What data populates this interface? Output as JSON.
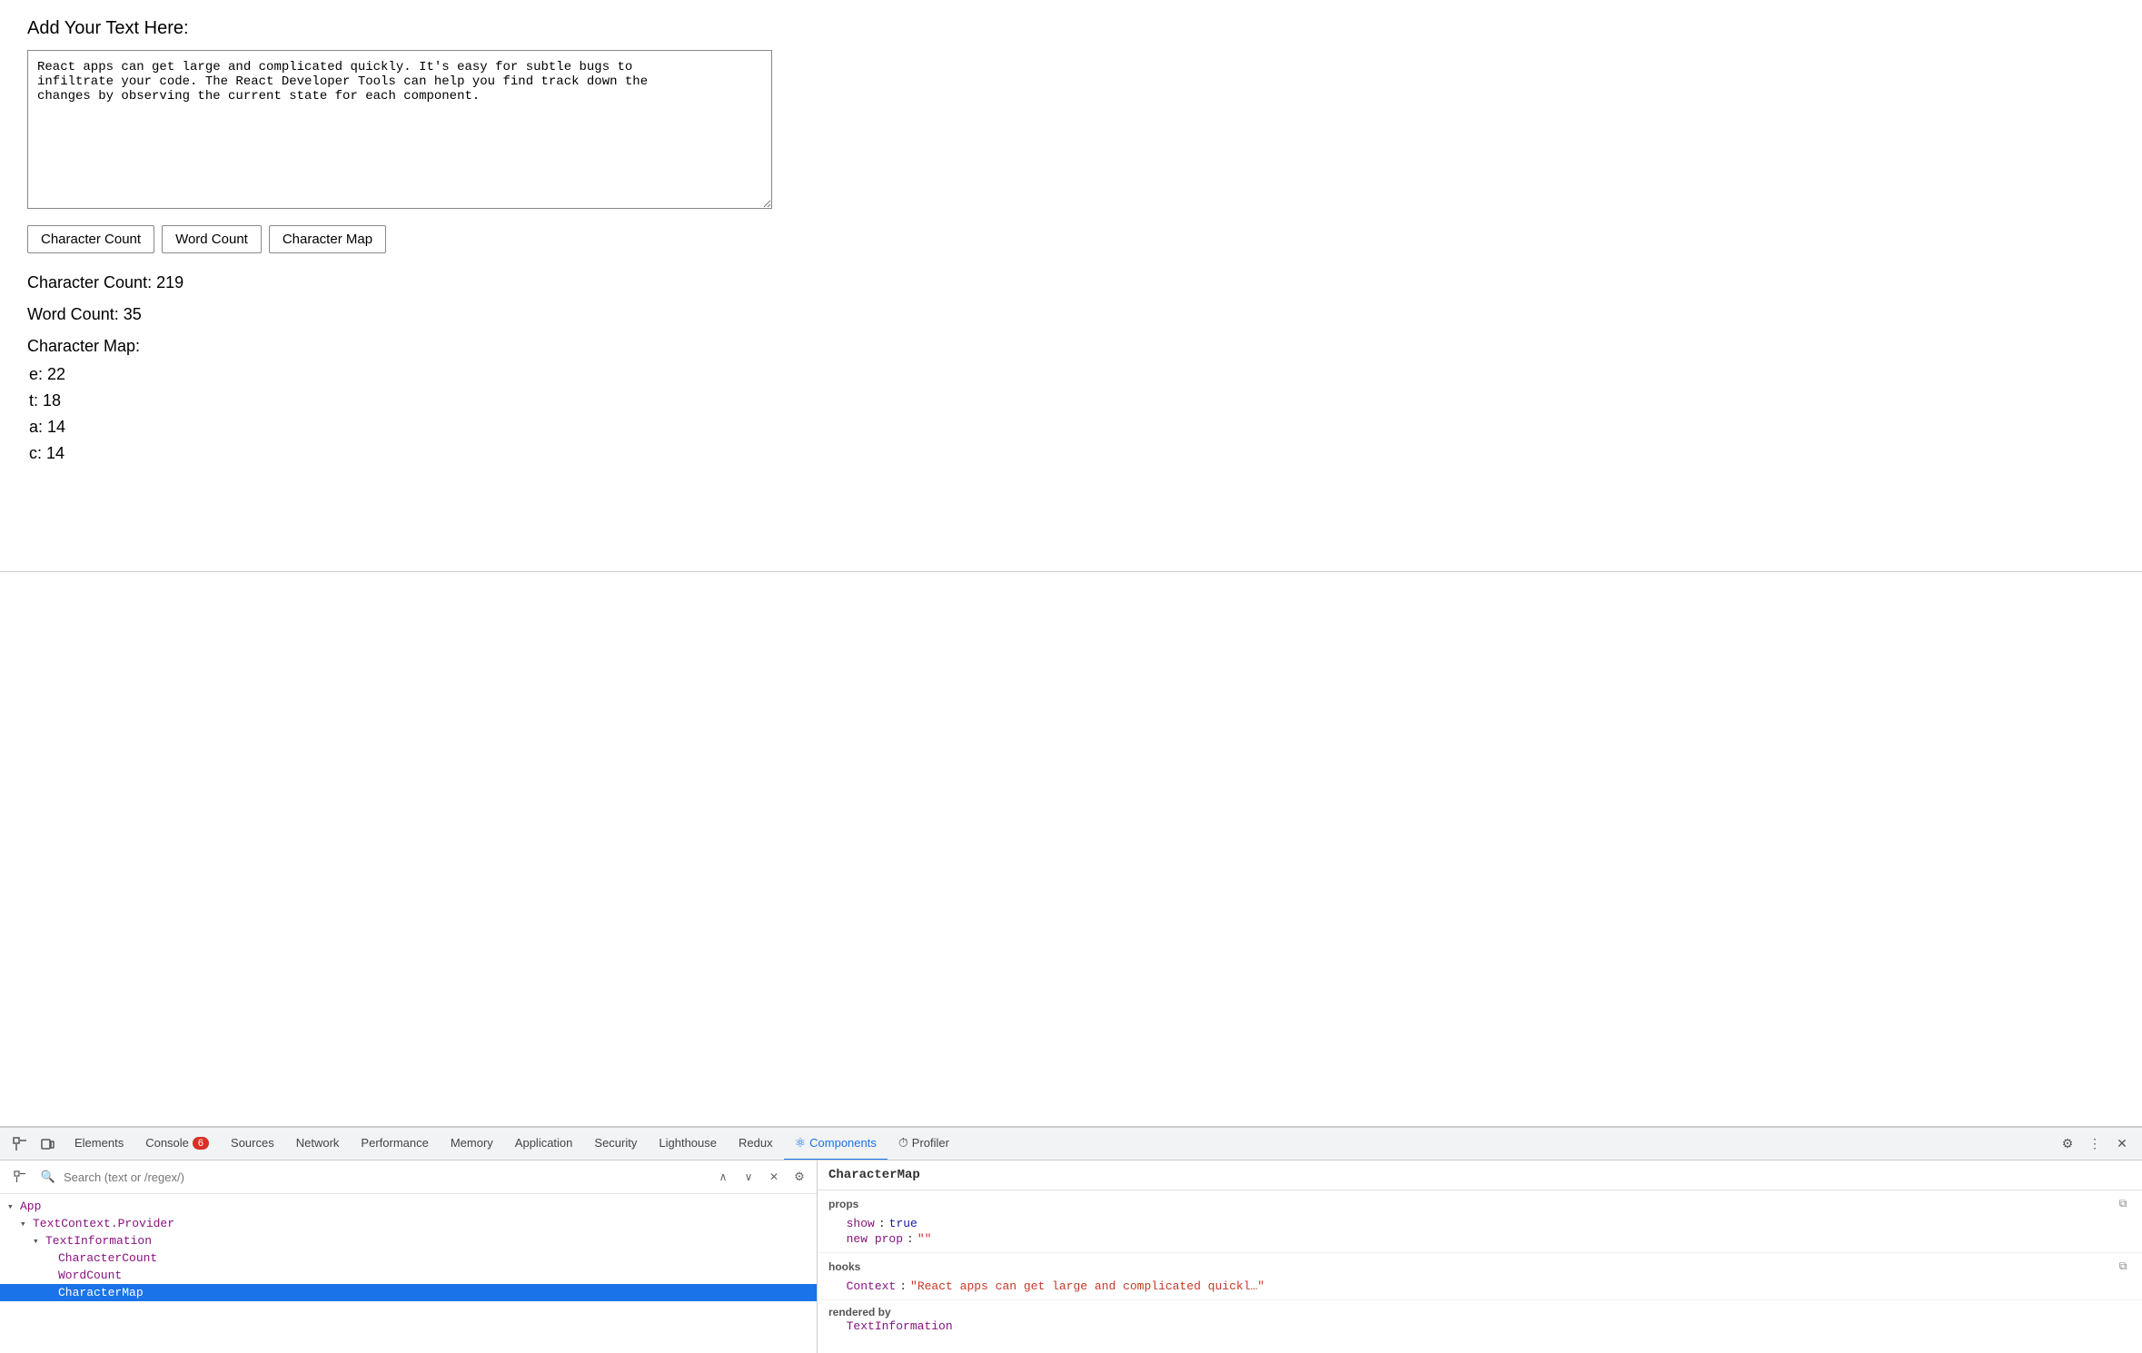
{
  "app": {
    "label": "Add Your Text Here:",
    "textarea": {
      "value": "React apps can get large and complicated quickly. It's easy for subtle bugs to\ninfiltrate your code. The React Developer Tools can help you find track down the\nchanges by observing the current state for each component."
    },
    "buttons": [
      {
        "id": "char-count-btn",
        "label": "Character Count"
      },
      {
        "id": "word-count-btn",
        "label": "Word Count"
      },
      {
        "id": "char-map-btn",
        "label": "Character Map"
      }
    ],
    "results": {
      "charCount": "Character Count: 219",
      "wordCount": "Word Count: 35",
      "charMap": "Character Map:",
      "charEntries": [
        "e: 22",
        "t: 18",
        "a: 14",
        "c: 14"
      ]
    }
  },
  "devtools": {
    "tabs": [
      {
        "id": "elements",
        "label": "Elements",
        "active": false
      },
      {
        "id": "console",
        "label": "Console",
        "active": false
      },
      {
        "id": "sources",
        "label": "Sources",
        "active": false
      },
      {
        "id": "network",
        "label": "Network",
        "active": false
      },
      {
        "id": "performance",
        "label": "Performance",
        "active": false
      },
      {
        "id": "memory",
        "label": "Memory",
        "active": false
      },
      {
        "id": "application",
        "label": "Application",
        "active": false
      },
      {
        "id": "security",
        "label": "Security",
        "active": false
      },
      {
        "id": "lighthouse",
        "label": "Lighthouse",
        "active": false
      },
      {
        "id": "redux",
        "label": "Redux",
        "active": false
      },
      {
        "id": "components",
        "label": "Components",
        "active": true,
        "hasIcon": true
      },
      {
        "id": "profiler",
        "label": "Profiler",
        "active": false,
        "hasIcon": true
      }
    ],
    "errorBadge": "6",
    "search": {
      "placeholder": "Search (text or /regex/)"
    },
    "componentTree": [
      {
        "id": "app",
        "label": "App",
        "indent": 0,
        "hasArrow": true,
        "arrowDown": true
      },
      {
        "id": "textcontext-provider",
        "label": "TextContext.Provider",
        "indent": 1,
        "hasArrow": true,
        "arrowDown": true
      },
      {
        "id": "textinformation",
        "label": "TextInformation",
        "indent": 2,
        "hasArrow": true,
        "arrowDown": true
      },
      {
        "id": "charactercount",
        "label": "CharacterCount",
        "indent": 3,
        "hasArrow": false
      },
      {
        "id": "wordcount",
        "label": "WordCount",
        "indent": 3,
        "hasArrow": false
      },
      {
        "id": "charactermap",
        "label": "CharacterMap",
        "indent": 3,
        "hasArrow": false,
        "selected": true
      }
    ],
    "rightPanel": {
      "title": "CharacterMap",
      "props": {
        "label": "props",
        "entries": [
          {
            "key": "show",
            "colon": ":",
            "value": "true",
            "type": "bool"
          },
          {
            "key": "new prop",
            "colon": ":",
            "value": "\"\"",
            "type": "string"
          }
        ]
      },
      "hooks": {
        "label": "hooks",
        "entries": [
          {
            "key": "Context",
            "colon": ":",
            "value": "\"React apps can get large and complicated quickl…\"",
            "type": "string"
          }
        ]
      },
      "renderedBy": {
        "label": "rendered by",
        "component": "TextInformation"
      }
    }
  }
}
